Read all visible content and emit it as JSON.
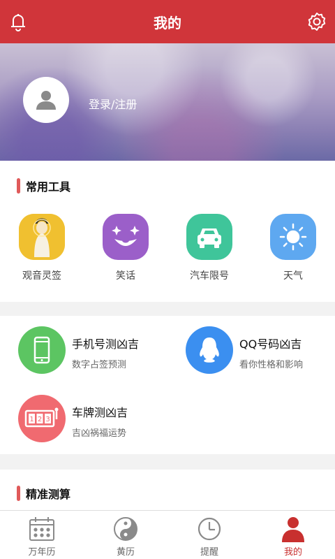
{
  "header": {
    "title": "我的",
    "bell_icon": "bell-icon",
    "settings_icon": "gear-icon"
  },
  "profile": {
    "login_text": "登录/注册",
    "avatar_icon": "user-icon"
  },
  "tools": {
    "section_title": "常用工具",
    "items": [
      {
        "label": "观音灵签",
        "icon": "guanyin-icon",
        "color": "#f2c230"
      },
      {
        "label": "笑话",
        "icon": "clown-icon",
        "color": "#9b5fc9"
      },
      {
        "label": "汽车限号",
        "icon": "car-icon",
        "color": "#3fc59a"
      },
      {
        "label": "天气",
        "icon": "sun-icon",
        "color": "#5ea8f0"
      }
    ]
  },
  "fortune": {
    "items": [
      {
        "title": "手机号测凶吉",
        "subtitle": "数字占签预测",
        "icon": "phone-icon",
        "color": "#5cc562"
      },
      {
        "title": "QQ号码凶吉",
        "subtitle": "看你性格和影响",
        "icon": "qq-penguin-icon",
        "color": "#3b8ff0"
      },
      {
        "title": "车牌测凶吉",
        "subtitle": "吉凶祸福运势",
        "icon": "slot-machine-icon",
        "color": "#f06a70"
      }
    ]
  },
  "precise": {
    "section_title": "精准测算"
  },
  "tabbar": {
    "tabs": [
      {
        "label": "万年历",
        "icon": "calendar-icon"
      },
      {
        "label": "黄历",
        "icon": "yin-yang-icon"
      },
      {
        "label": "提醒",
        "icon": "clock-icon"
      },
      {
        "label": "我的",
        "icon": "person-icon",
        "active": true
      }
    ]
  },
  "colors": {
    "primary": "#d0353a",
    "accent_bar": "#e05a5a",
    "active_tab": "#c8302f"
  }
}
